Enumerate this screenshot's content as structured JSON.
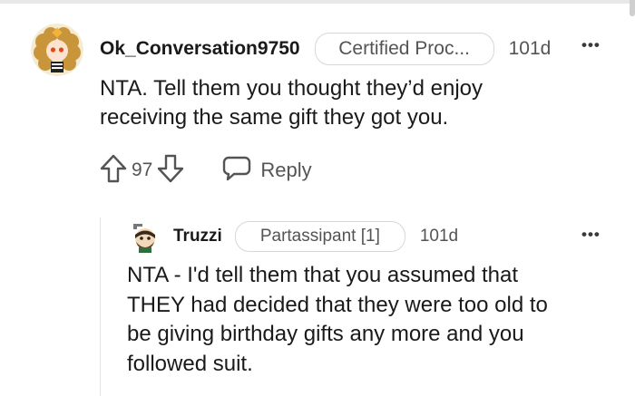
{
  "comments": [
    {
      "username": "Ok_Conversation9750",
      "flair": "Certified Proc...",
      "time": "101d",
      "more": "•••",
      "body_lines": [
        "NTA. Tell them you thought they’d enjoy",
        "receiving the same gift they got you."
      ],
      "votes": "97",
      "reply_label": "Reply",
      "avatar_icon": "snoo-avatar-curly-hair-icon"
    },
    {
      "username": "Truzzi",
      "flair": "Partassipant [1]",
      "time": "101d",
      "more": "•••",
      "body_lines": [
        "NTA - I'd tell them that you assumed that",
        "THEY had decided that they were too old to",
        "be giving birthday gifts any more and you",
        "followed suit."
      ],
      "avatar_icon": "snoo-avatar-bearded-icon"
    }
  ],
  "colors": {
    "text": "#1a1a1b",
    "meta": "#545454",
    "flair_border": "#d7d7d7",
    "avatar_hair": "#c9953a",
    "avatar_bg": "#f3e6c8"
  }
}
